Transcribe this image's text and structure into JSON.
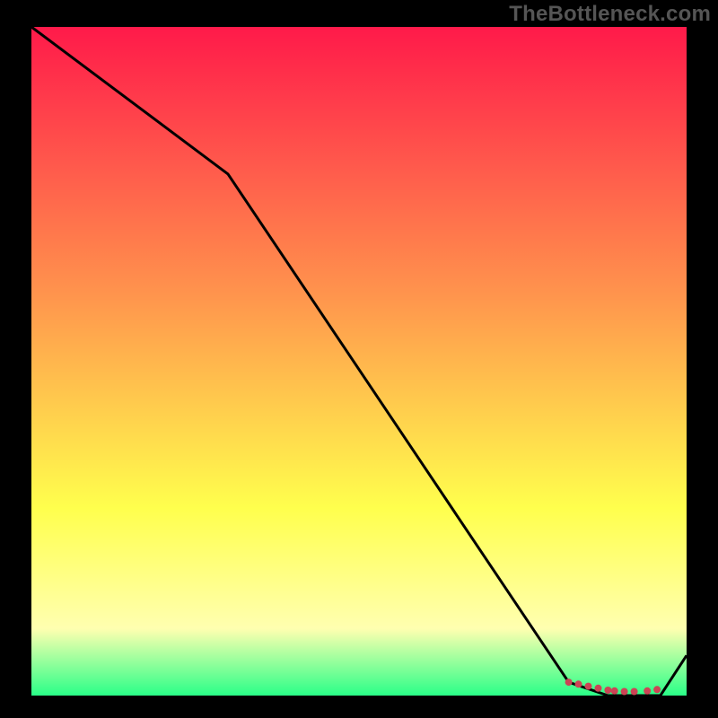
{
  "watermark": "TheBottleneck.com",
  "colors": {
    "frame": "#000000",
    "grad_top": "#ff1a4a",
    "grad_mid1": "#ff944d",
    "grad_mid2": "#ffff4d",
    "grad_low": "#ffffb0",
    "grad_bottom": "#2aff88",
    "line": "#000000",
    "marker": "#cc4455"
  },
  "chart_data": {
    "type": "line",
    "title": "",
    "xlabel": "",
    "ylabel": "",
    "xlim": [
      0,
      100
    ],
    "ylim": [
      0,
      100
    ],
    "x": [
      0,
      30,
      82,
      88,
      96,
      100
    ],
    "values": [
      100,
      78,
      2,
      0,
      0,
      6
    ],
    "markers_x": [
      82,
      83.5,
      85,
      86.5,
      88,
      89,
      90.5,
      92,
      94,
      95.5
    ],
    "markers_y": [
      2,
      1.7,
      1.4,
      1.1,
      0.8,
      0.7,
      0.6,
      0.6,
      0.7,
      0.9
    ]
  }
}
